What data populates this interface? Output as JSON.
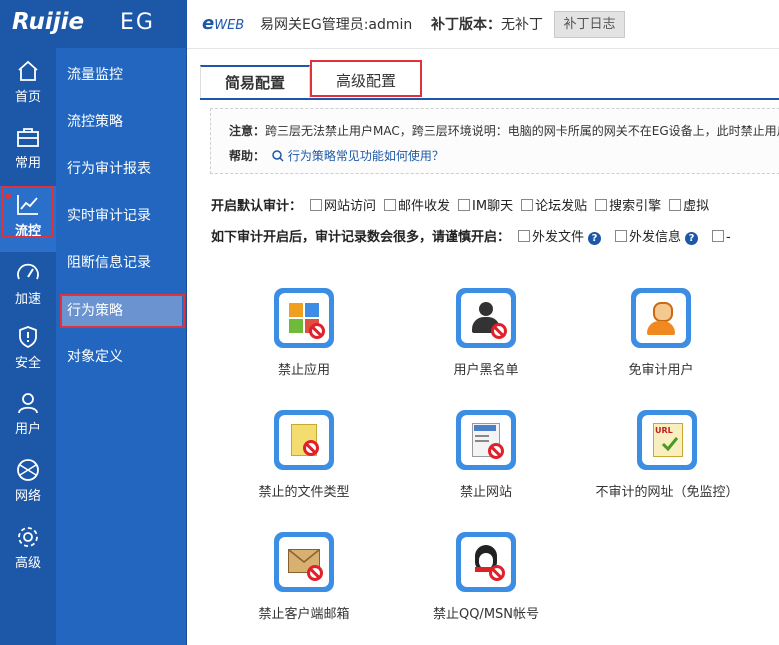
{
  "app": {
    "brand": "Ruijie",
    "product": "EG",
    "eweb": "e",
    "eweb_small": "WEB",
    "admin_label": "易网关EG管理员:admin",
    "patch_label": "补丁版本：",
    "patch_value": "无补丁",
    "patch_log_button": "补丁日志"
  },
  "sidebar": {
    "items": [
      {
        "label": "首页",
        "icon": "home-icon"
      },
      {
        "label": "常用",
        "icon": "toolbox-icon"
      },
      {
        "label": "流控",
        "icon": "chart-icon"
      },
      {
        "label": "加速",
        "icon": "speedometer-icon"
      },
      {
        "label": "安全",
        "icon": "shield-icon"
      },
      {
        "label": "用户",
        "icon": "user-icon"
      },
      {
        "label": "网络",
        "icon": "globe-icon"
      },
      {
        "label": "高级",
        "icon": "gear-icon"
      }
    ]
  },
  "subnav": {
    "items": [
      "流量监控",
      "流控策略",
      "行为审计报表",
      "实时审计记录",
      "阻断信息记录",
      "行为策略",
      "对象定义"
    ]
  },
  "tabs": {
    "simple": "简易配置",
    "advanced": "高级配置"
  },
  "notice": {
    "note_label": "注意：",
    "note_text": "跨三层无法禁止用户MAC，跨三层环境说明：电脑的网卡所属的网关不在EG设备上，此时禁止用户MAC",
    "help_label": "帮助：",
    "help_link": "行为策略常见功能如何使用？"
  },
  "audit": {
    "default_label": "开启默认审计：",
    "default_items": [
      "网站访问",
      "邮件收发",
      "IM聊天",
      "论坛发贴",
      "搜索引擎",
      "虚拟"
    ],
    "warn_label": "如下审计开启后，审计记录数会很多，请谨慎开启：",
    "warn_items": [
      "外发文件",
      "外发信息",
      "-"
    ]
  },
  "tiles": [
    "禁止应用",
    "用户黑名单",
    "免审计用户",
    "禁止的文件类型",
    "禁止网站",
    "不审计的网址（免监控）",
    "禁止客户端邮箱",
    "禁止QQ/MSN帐号"
  ],
  "colors": {
    "sidebar": "#1d58a8",
    "subnav": "#2266bf",
    "accent": "#3c8ee4",
    "highlight": "#e0323a"
  }
}
